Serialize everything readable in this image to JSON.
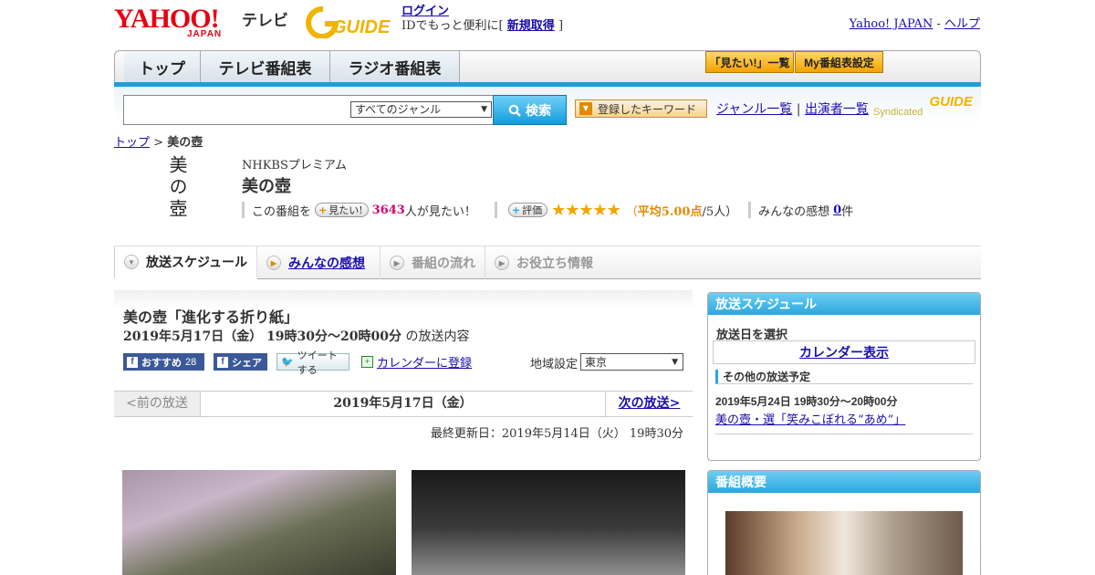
{
  "header": {
    "logo_yahoo": "YAHOO!",
    "logo_japan": "JAPAN",
    "logo_tv": "テレビ",
    "logo_gguide": "GUIDE",
    "login_link": "ログイン",
    "login_prompt_prefix": "IDでもっと便利に[",
    "signup_link": "新規取得",
    "login_prompt_suffix": "]",
    "yahoo_japan_link": "Yahoo! JAPAN",
    "separator": "-",
    "help_link": "ヘルプ"
  },
  "nav": {
    "tabs": [
      "トップ",
      "テレビ番組表",
      "ラジオ番組表"
    ],
    "want_list_button": "「見たい!」一覧",
    "my_schedule_button": "My番組表設定"
  },
  "search": {
    "placeholder": "",
    "genre_selected": "すべてのジャンル",
    "search_button": "検索",
    "keyword_button": "登録したキーワード",
    "genre_list_link": "ジャンル一覧",
    "divider": "|",
    "cast_list_link": "出演者一覧",
    "syndicated": "Syndicated",
    "syndicated_logo": "GUIDE"
  },
  "breadcrumb": {
    "home": "トップ",
    "separator": ">",
    "current": "美の壺"
  },
  "program": {
    "channel": "NHKBSプレミアム",
    "title": "美の壺",
    "logo_text": "美の壺",
    "want_prefix": "この番組を",
    "want_button": "見たい!",
    "want_count": "3643",
    "want_suffix": "人が見たい！",
    "rate_button": "評価",
    "stars": "★★★★★",
    "rating_open": "（",
    "rating_label": "平均5.00点",
    "rating_count": "/5人）",
    "comments_label": "みんなの感想",
    "comments_count": "0",
    "comments_unit": "件"
  },
  "tabs": [
    "放送スケジュール",
    "みんなの感想",
    "番組の流れ",
    "お役立ち情報"
  ],
  "episode": {
    "title": "美の壺「進化する折り紙」",
    "datetime": "2019年5月17日（金）  19時30分～20時00分",
    "datetime_suffix": "の放送内容",
    "recommend_label": "おすすめ",
    "recommend_count": "28",
    "share_label": "シェア",
    "tweet_label": "ツイートする",
    "calendar_link": "カレンダーに登録",
    "region_label": "地域設定",
    "region_value": "東京",
    "prev_broadcast": "<前の放送",
    "current_date": "2019年5月17日（金）",
    "next_broadcast": "次の放送>",
    "last_updated": "最終更新日：2019年5月14日（火）  19時30分"
  },
  "sidebar": {
    "schedule_title": "放送スケジュール",
    "select_date_label": "放送日を選択",
    "calendar_button": "カレンダー表示",
    "other_schedule_title": "その他の放送予定",
    "next_datetime": "2019年5月24日  19時30分～20時00分",
    "next_episode_link": "美の壺・選「笑みこぼれる“あめ”」",
    "overview_title": "番組概要"
  },
  "colors": {
    "accent_blue": "#1d9fd8",
    "yahoo_red": "#e60012",
    "want_count_pink": "#d6006f",
    "rating_orange": "#e08a00"
  }
}
